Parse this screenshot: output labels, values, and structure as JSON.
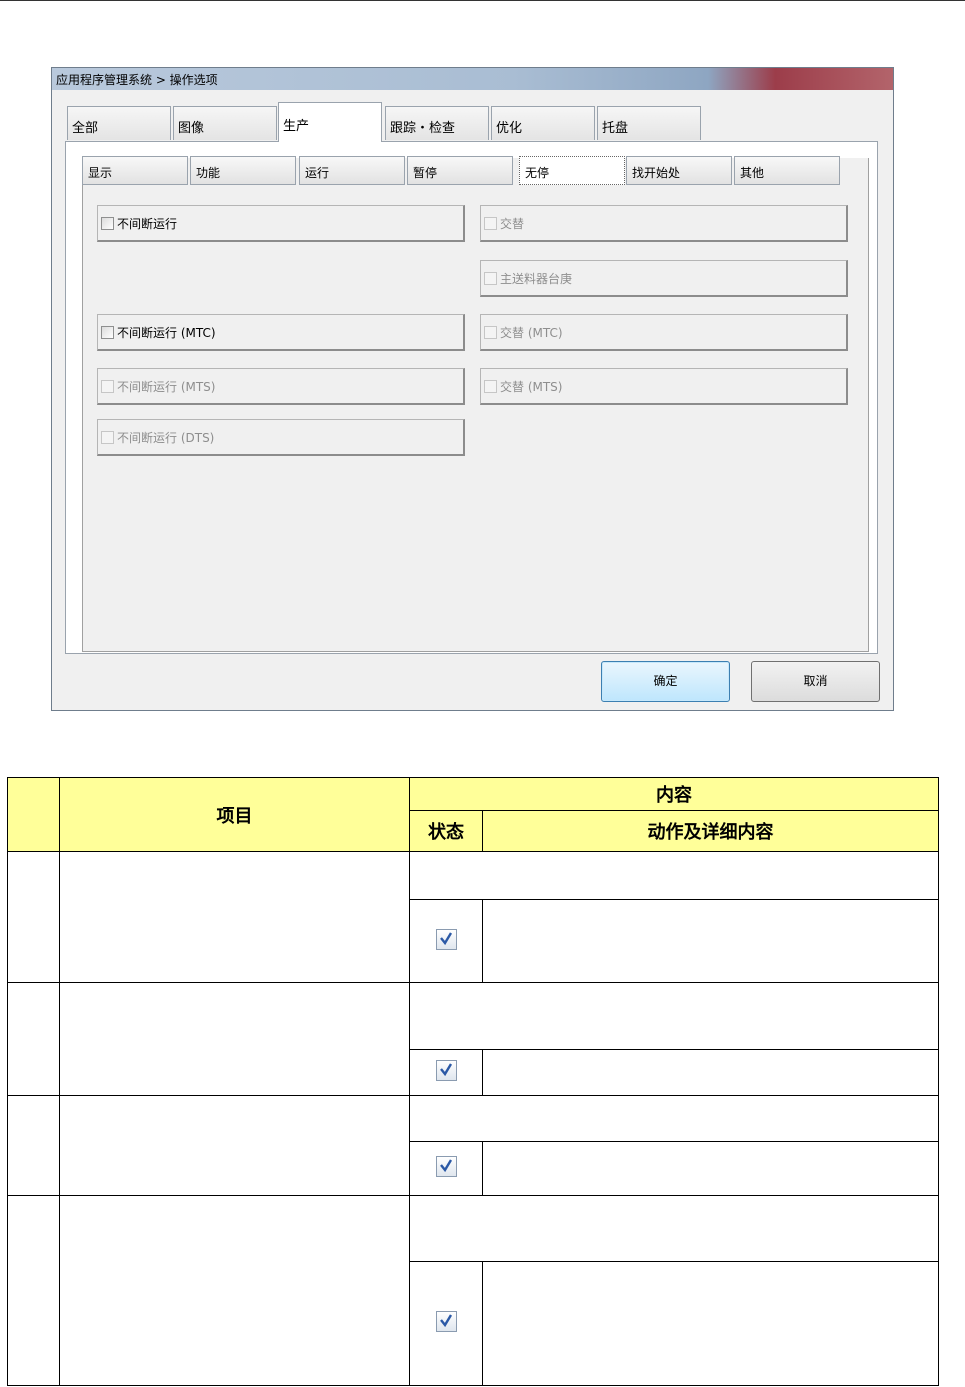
{
  "dialog": {
    "title": "应用程序管理系统 > 操作选项",
    "main_tabs": [
      {
        "label": "全部",
        "active": false
      },
      {
        "label": "图像",
        "active": false
      },
      {
        "label": "生产",
        "active": true
      },
      {
        "label": "跟踪・检查",
        "active": false
      },
      {
        "label": "优化",
        "active": false
      },
      {
        "label": "托盘",
        "active": false
      }
    ],
    "sub_tabs": [
      {
        "label": "显示",
        "active": false
      },
      {
        "label": "功能",
        "active": false
      },
      {
        "label": "运行",
        "active": false
      },
      {
        "label": "暂停",
        "active": false
      },
      {
        "label": "无停",
        "active": true
      },
      {
        "label": "找开始处",
        "active": false
      },
      {
        "label": "其他",
        "active": false
      }
    ],
    "options_left": [
      {
        "label": "不间断运行",
        "enabled": true,
        "checked": false
      },
      {
        "label": "不间断运行 (MTC)",
        "enabled": true,
        "checked": false
      },
      {
        "label": "不间断运行 (MTS)",
        "enabled": false,
        "checked": false
      },
      {
        "label": "不间断运行 (DTS)",
        "enabled": false,
        "checked": false
      }
    ],
    "options_right": [
      {
        "label": "交替",
        "enabled": false,
        "checked": false
      },
      {
        "label": "主送料器台庚",
        "enabled": false,
        "checked": false
      },
      {
        "label": "交替 (MTC)",
        "enabled": false,
        "checked": false
      },
      {
        "label": "交替 (MTS)",
        "enabled": false,
        "checked": false
      }
    ],
    "ok_label": "确定",
    "cancel_label": "取消"
  },
  "table": {
    "header_item": "项目",
    "header_content": "内容",
    "header_state": "状态",
    "header_detail": "动作及详细内容",
    "rows": [
      {
        "checked": true
      },
      {
        "checked": true
      },
      {
        "checked": true
      },
      {
        "checked": true
      }
    ]
  }
}
